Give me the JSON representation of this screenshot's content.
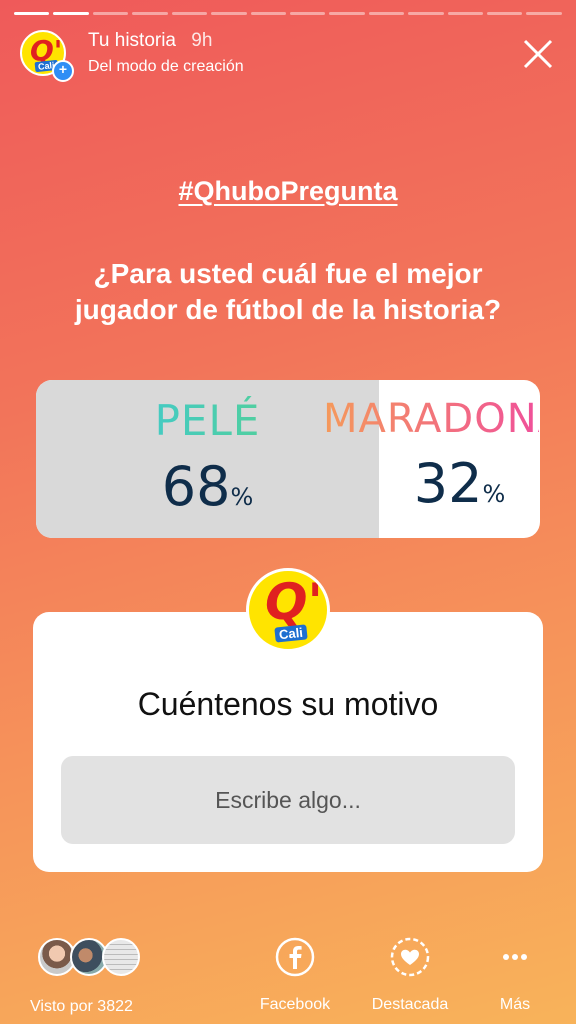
{
  "header": {
    "title": "Tu historia",
    "time": "9h",
    "subtitle": "Del modo de creación"
  },
  "logo": {
    "letter": "Q'",
    "city": "Cali"
  },
  "story": {
    "hashtag": "#QhuboPregunta",
    "question_line1": "¿Para usted cuál fue el mejor",
    "question_line2": "jugador de fútbol de la historia?"
  },
  "poll": {
    "option_a": {
      "label": "PELÉ",
      "percent": "68",
      "value": 0.68
    },
    "option_b": {
      "label": "MARADONA",
      "percent": "32",
      "value": 0.32
    },
    "percent_sign": "%"
  },
  "question_sticker": {
    "title": "Cuéntenos su motivo",
    "placeholder": "Escribe algo..."
  },
  "footer": {
    "seen_by": "Visto por 3822",
    "facebook": "Facebook",
    "highlight": "Destacada",
    "more": "Más"
  },
  "colors": {
    "background_top": "#ef5a5a",
    "background_bottom": "#f8b35a",
    "logo_yellow": "#ffe400",
    "logo_red": "#e02020",
    "percent_text": "#0f2d4a"
  }
}
